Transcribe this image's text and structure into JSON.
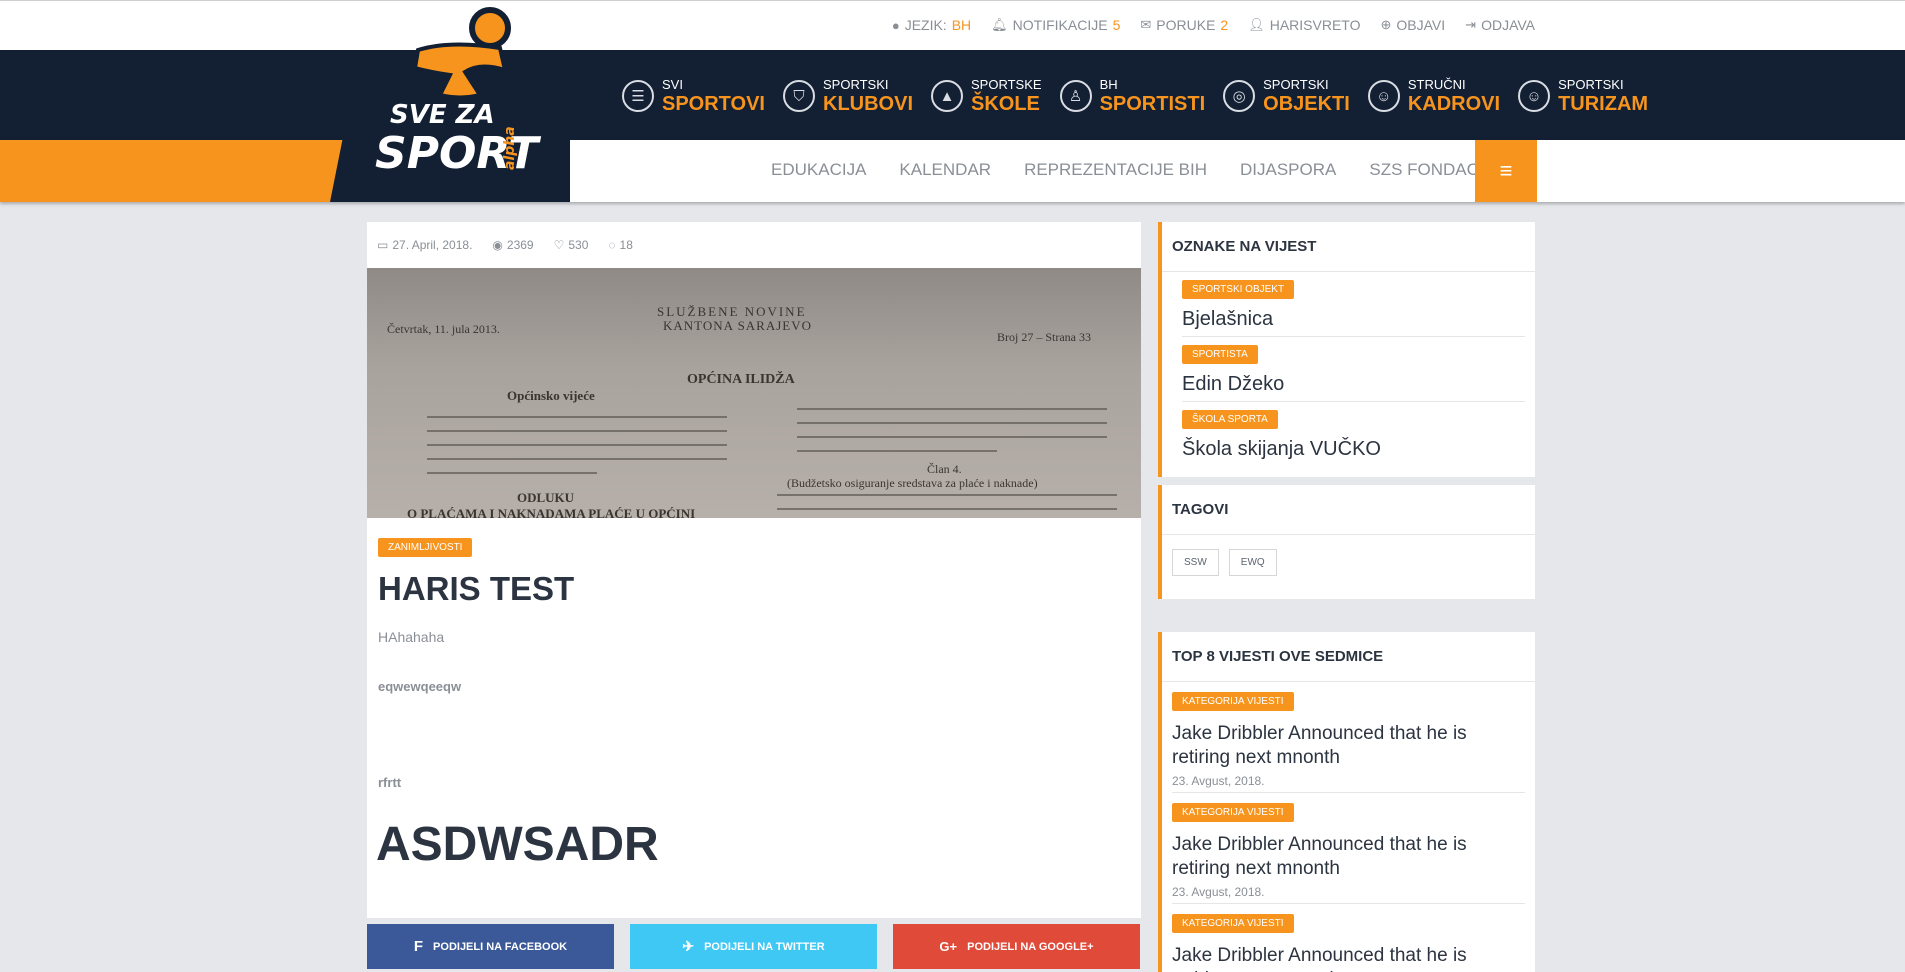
{
  "topbar": {
    "language_label": "JEZIK:",
    "language_value": "BH",
    "notifications_label": "NOTIFIKACIJE",
    "notifications_count": "5",
    "messages_label": "PORUKE",
    "messages_count": "2",
    "user": "HARISVRETO",
    "publish": "OBJAVI",
    "logout": "ODJAVA"
  },
  "logo": {
    "top": "SVE ZA",
    "bottom": "SPORT",
    "alpha": "alpha"
  },
  "nav": [
    {
      "small": "SVI",
      "big": "SPORTOVI",
      "icon": "list-icon"
    },
    {
      "small": "SPORTSKI",
      "big": "KLUBOVI",
      "icon": "shield-icon"
    },
    {
      "small": "SPORTSKE",
      "big": "ŠKOLE",
      "icon": "cone-icon"
    },
    {
      "small": "BH",
      "big": "SPORTISTI",
      "icon": "athletes-icon"
    },
    {
      "small": "SPORTSKI",
      "big": "OBJEKTI",
      "icon": "stadium-icon"
    },
    {
      "small": "STRUČNI",
      "big": "KADROVI",
      "icon": "person-icon"
    },
    {
      "small": "SPORTSKI",
      "big": "TURIZAM",
      "icon": "person-icon"
    }
  ],
  "subnav": [
    "EDUKACIJA",
    "KALENDAR",
    "REPREZENTACIJE BIH",
    "DIJASPORA",
    "SZS FONDACIJA"
  ],
  "article": {
    "date": "27. April, 2018.",
    "views": "2369",
    "likes": "530",
    "comments": "18",
    "category": "ZANIMLJIVOSTI",
    "title": "HARIS TEST",
    "p1": "HAhahaha",
    "p2": "eqwewqeeqw",
    "p3": "rfrtt",
    "heading": "ASDWSADR",
    "hero_text": {
      "title_line1": "SLUŽBENE NOVINE",
      "title_line2": "KANTONA SARAJEVO",
      "left_date": "Četvrtak, 11. jula 2013.",
      "right_num": "Broj 27 – Strana 33",
      "section": "OPĆINA ILIDŽA",
      "council": "Općinsko vijeće",
      "decision": "ODLUKU",
      "decision_sub": "O PLAĆAMA I NAKNADAMA PLAĆE U OPĆINI",
      "article": "Član 4.",
      "article_sub": "(Budžetsko osiguranje sredstava za plaće i naknade)"
    }
  },
  "share": {
    "facebook": "PODIJELI NA FACEBOOK",
    "twitter": "PODIJELI NA TWITTER",
    "google": "PODIJELI NA GOOGLE+"
  },
  "sidebar": {
    "tags_title": "OZNAKE NA VIJEST",
    "tags": [
      {
        "badge": "SPORTSKI OBJEKT",
        "name": "Bjelašnica"
      },
      {
        "badge": "SPORTISTA",
        "name": "Edin Džeko"
      },
      {
        "badge": "ŠKOLA SPORTA",
        "name": "Škola skijanja VUČKO"
      }
    ],
    "tagovi_title": "TAGOVI",
    "chips": [
      "SSW",
      "EWQ"
    ],
    "top_title": "TOP 8 VIJESTI OVE SEDMICE",
    "news": [
      {
        "badge": "KATEGORIJA VIJESTI",
        "title": "Jake Dribbler Announced that he is retiring next mnonth",
        "date": "23. Avgust, 2018."
      },
      {
        "badge": "KATEGORIJA VIJESTI",
        "title": "Jake Dribbler Announced that he is retiring next mnonth",
        "date": "23. Avgust, 2018."
      },
      {
        "badge": "KATEGORIJA VIJESTI",
        "title": "Jake Dribbler Announced that he is retiring next mnonth",
        "date": ""
      }
    ]
  },
  "colors": {
    "accent": "#f7941d",
    "navy": "#131f33",
    "facebook": "#3b5998",
    "twitter": "#3fc8f4",
    "google": "#e04a39"
  }
}
